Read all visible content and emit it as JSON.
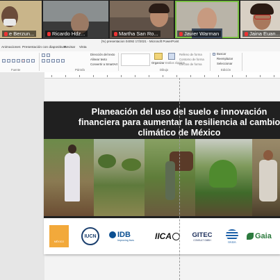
{
  "video_call": {
    "participants": [
      {
        "name": "e Berzun..."
      },
      {
        "name": "Ricardo  Hdz..."
      },
      {
        "name": "Martha San Ro..."
      },
      {
        "name": "Javier Warman"
      },
      {
        "name": "Jaina Euan..."
      }
    ]
  },
  "window": {
    "title": "(%) presentacion 04092 17/2021 - Microsoft PowerPoint"
  },
  "menu": {
    "tabs": [
      "Animaciones",
      "Presentación con diapositivas",
      "Revisar",
      "Vista"
    ]
  },
  "ribbon": {
    "items": {
      "direction": "Dirección del texto",
      "align": "Alinear texto",
      "smartart": "Convertir a SmartArt",
      "organize": "Organizar",
      "styles": "Estilos rápidos",
      "fill": "Relleno de forma",
      "outline": "Contorno de forma",
      "effects": "Efectos de forma",
      "find": "Buscar",
      "replace": "Reemplazar",
      "select": "Seleccionar"
    },
    "groups": {
      "font": "Fuente",
      "paragraph": "Párrafo",
      "drawing": "Dibujo",
      "editing": "Edición"
    }
  },
  "slide": {
    "title_line1": "Planeación del uso del suelo e innovación",
    "title_line2": "financiera para aumentar la resiliencia al cambio",
    "title_line3": "climático de México",
    "logos": {
      "mexico": "MÉXICO",
      "iucn": "IUCN",
      "idb": "IDB",
      "idb_sub": "Improving lives",
      "iica": "IICA",
      "gitec": "GITEC",
      "gitec_sub": "CONSULT GMBH",
      "iiasa": "IIASA",
      "gaia": "Gaia"
    }
  },
  "colors": {
    "slide_bg": "#202020",
    "active_speaker": "#7ac143",
    "idb_blue": "#0b4f91",
    "gaia_green": "#2c7a3e"
  }
}
